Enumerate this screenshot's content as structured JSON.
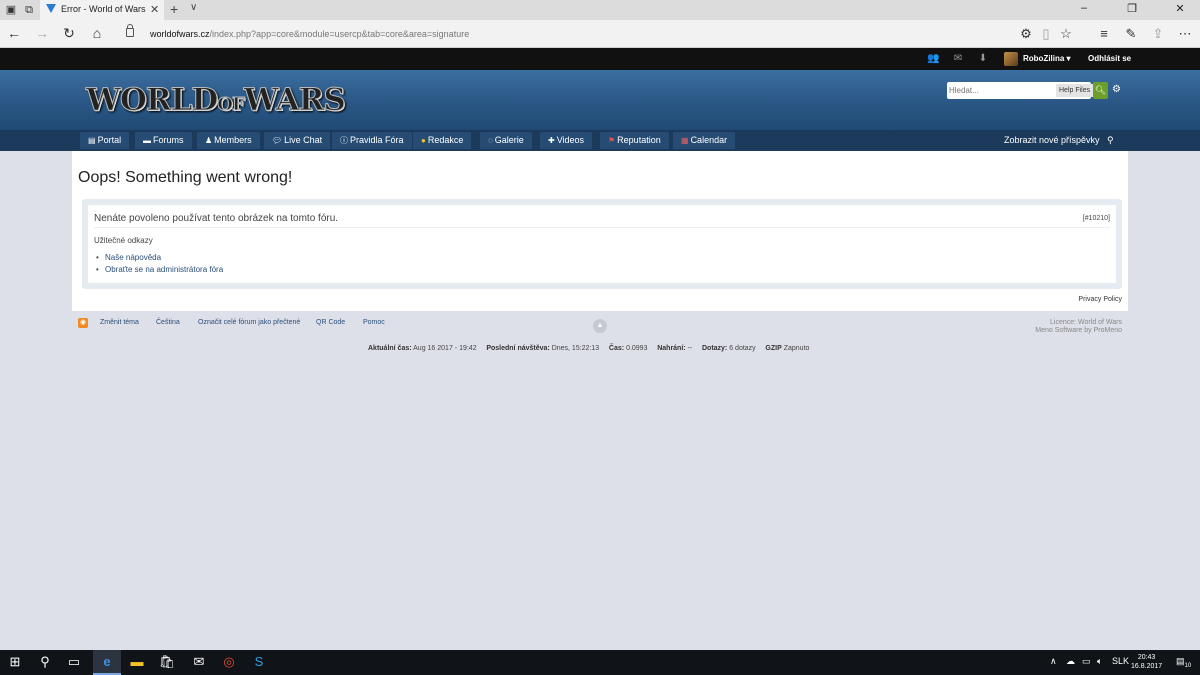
{
  "browser": {
    "tab_title": "Error - World of Wars",
    "url_host": "worldofwars.cz",
    "url_path": "/index.php?app=core&module=usercp&tab=core&area=signature"
  },
  "userbar": {
    "username": "RoboZilina",
    "logout": "Odhlásit se"
  },
  "header": {
    "logo_part1": "WORLD",
    "logo_part2": "OF",
    "logo_part3": "WARS",
    "search_placeholder": "Hledat...",
    "search_scope": "Help Files"
  },
  "nav": {
    "items": [
      {
        "label": "Portal",
        "icon": "portal-icon"
      },
      {
        "label": "Forums",
        "icon": "forums-icon"
      },
      {
        "label": "Members",
        "icon": "members-icon"
      },
      {
        "label": "Live Chat",
        "icon": "chat-icon"
      },
      {
        "label": "Pravidla Fóra",
        "icon": "info-icon"
      },
      {
        "label": "Redakce",
        "icon": "smiley-icon"
      },
      {
        "label": "Galerie",
        "icon": "gallery-icon"
      },
      {
        "label": "Videos",
        "icon": "videos-icon"
      },
      {
        "label": "Reputation",
        "icon": "reputation-icon"
      },
      {
        "label": "Calendar",
        "icon": "calendar-icon"
      }
    ],
    "new_posts": "Zobrazit nové příspěvky"
  },
  "content": {
    "title": "Oops! Something went wrong!",
    "error_message": "Nenáte povoleno používat tento obrázek na tomto fóru.",
    "error_code": "[#10210]",
    "useful_links_title": "Užitečné odkazy",
    "links": [
      "Naše nápověda",
      "Obraťte se na administrátora fóra"
    ],
    "privacy": "Privacy Policy"
  },
  "footer": {
    "links": [
      "Změnit téma",
      "Čeština",
      "Označit celé fórum jako přečtené",
      "QR Code",
      "Pomoc"
    ],
    "licence": "Licence: World of Wars",
    "software": "Meno Software by ProMeno",
    "stats": {
      "time_label": "Aktuální čas:",
      "time_value": "Aug 16 2017 - 19:42",
      "last_visit_label": "Poslední návštěva:",
      "last_visit_value": "Dnes, 15:22:13",
      "exec_label": "Čas:",
      "exec_value": "0.0993",
      "load_label": "Nahrání:",
      "load_value": "--",
      "queries_label": "Dotazy:",
      "queries_value": "6 dotazy",
      "gzip_label": "GZIP",
      "gzip_value": "Zapnuto"
    }
  },
  "taskbar": {
    "lang": "SLK",
    "time": "20:43",
    "date": "16.8.2017",
    "notifications": "10"
  }
}
